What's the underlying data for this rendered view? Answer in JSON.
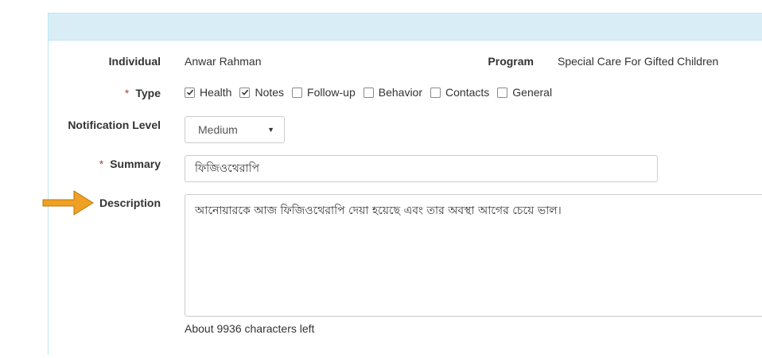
{
  "form": {
    "individual": {
      "label": "Individual",
      "value": "Anwar Rahman"
    },
    "program": {
      "label": "Program",
      "value": "Special Care For Gifted Children"
    },
    "type": {
      "required_mark": "*",
      "label": "Type",
      "options": [
        {
          "label": "Health",
          "checked": true
        },
        {
          "label": "Notes",
          "checked": true
        },
        {
          "label": "Follow-up",
          "checked": false
        },
        {
          "label": "Behavior",
          "checked": false
        },
        {
          "label": "Contacts",
          "checked": false
        },
        {
          "label": "General",
          "checked": false
        }
      ]
    },
    "notification_level": {
      "label": "Notification Level",
      "selected": "Medium"
    },
    "summary": {
      "required_mark": "*",
      "label": "Summary",
      "value": "ফিজিওথেরাপি"
    },
    "description": {
      "label": "Description",
      "value": "আনোয়ারকে আজ ফিজিওথেরাপি দেয়া হয়েছে এবং তার অবস্থা আগের চেয়ে ভাল।",
      "chars_left": "About 9936 characters left"
    }
  },
  "annotation": {
    "icon": "arrow-right-icon",
    "color": "#f0a023"
  },
  "colors": {
    "panel_heading": "#d9edf7",
    "panel_border": "#bce8f1",
    "required": "#a94442"
  }
}
